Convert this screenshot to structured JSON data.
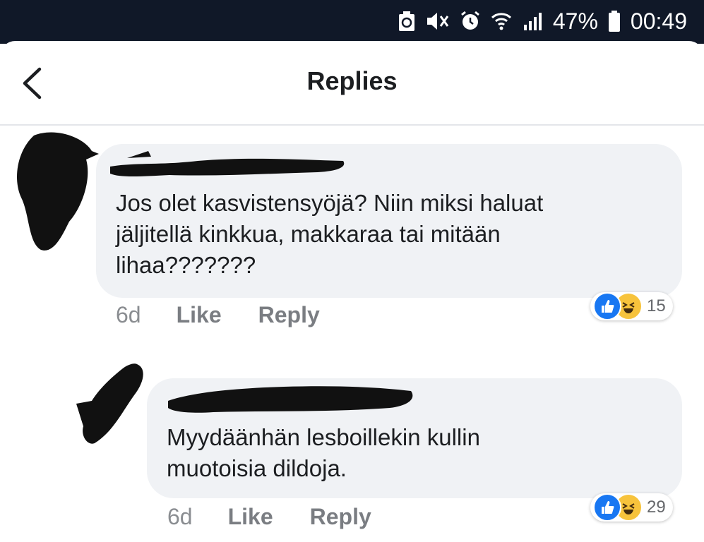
{
  "status_bar": {
    "battery": "47%",
    "time": "00:49"
  },
  "header": {
    "title": "Replies"
  },
  "comments": [
    {
      "text_lines": [
        "Jos olet kasvistensyöjä? Niin miksi haluat",
        "jäljitellä kinkkua, makkaraa tai mitään",
        "lihaa???????"
      ],
      "time": "6d",
      "like_label": "Like",
      "reply_label": "Reply",
      "reaction_count": "15",
      "reactions": [
        "like-icon",
        "haha-icon"
      ]
    },
    {
      "text_lines": [
        "Myydäänhän lesboillekin kullin",
        "muotoisia dildoja."
      ],
      "time": "6d",
      "like_label": "Like",
      "reply_label": "Reply",
      "reaction_count": "29",
      "reactions": [
        "like-icon",
        "haha-icon"
      ]
    }
  ],
  "colors": {
    "status_bar_bg": "#101828",
    "bubble_bg": "#f0f2f5",
    "like_blue": "#1877f2",
    "haha_yellow": "#f7c33c",
    "redaction": "#111111"
  }
}
